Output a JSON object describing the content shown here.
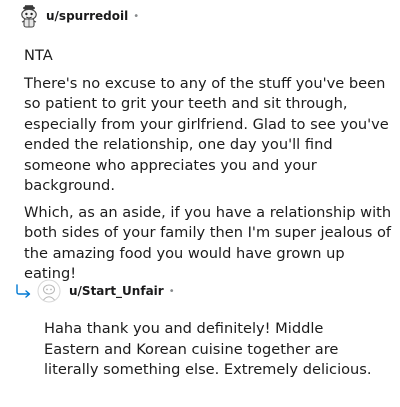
{
  "comment": {
    "username": "u/spurredoil",
    "separator": "•",
    "paragraphs": [
      "NTA",
      "There's no excuse to any of the stuff you've been so patient to grit your teeth and sit through, especially from your girlfriend. Glad to see you've ended the relationship, one day you'll find someone who appreciates you and your background.",
      "Which, as an aside, if you have a relationship with both sides of your family then I'm super jealous of the amazing food you would have grown up eating!"
    ]
  },
  "reply": {
    "username": "u/Start_Unfair",
    "separator": "•",
    "paragraphs": [
      "Haha thank you and definitely! Middle Eastern and Korean cuisine together are literally something else. Extremely delicious."
    ]
  },
  "icons": {
    "comment_avatar": "snoo-avatar-icon",
    "reply_avatar": "default-avatar-icon",
    "reply_indicator": "reply-arrow-icon"
  }
}
